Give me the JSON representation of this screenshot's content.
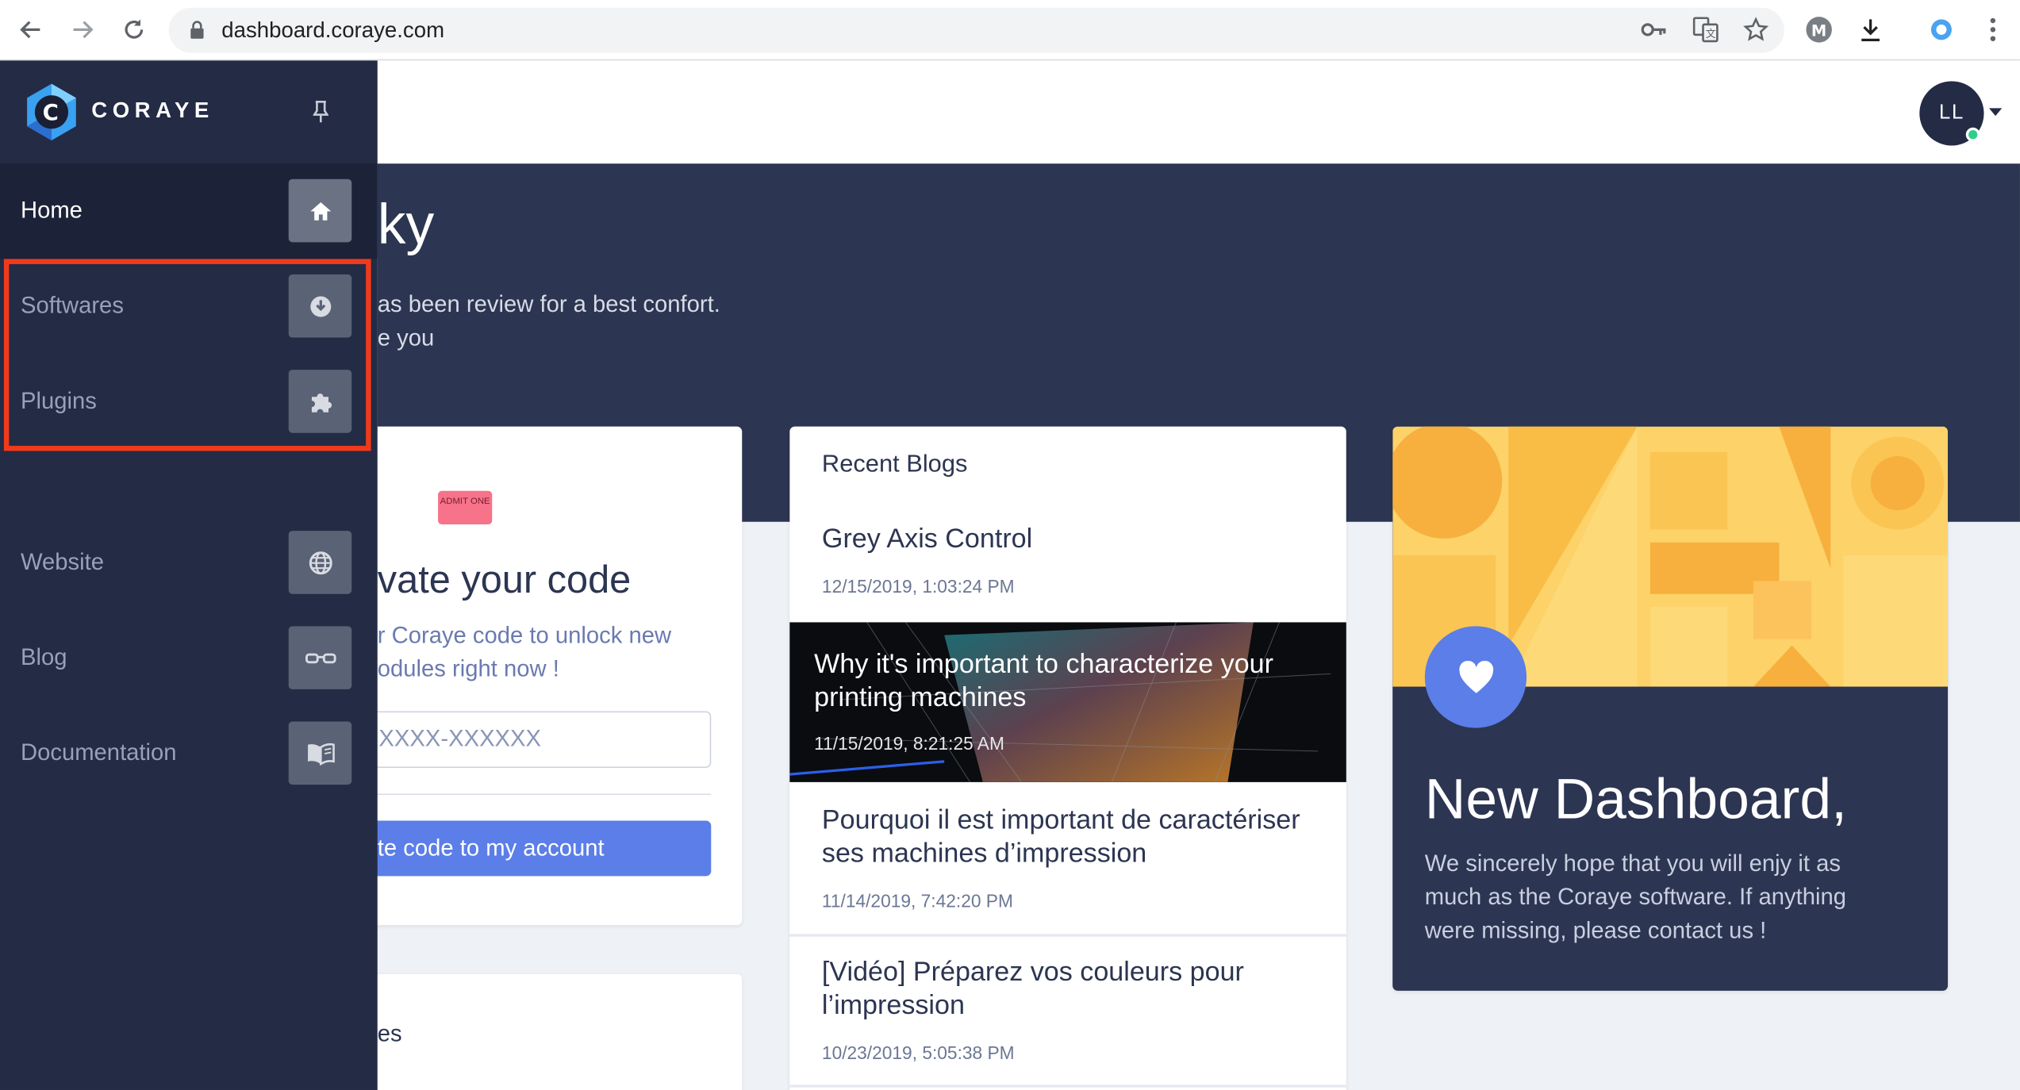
{
  "browser": {
    "url": "dashboard.coraye.com"
  },
  "sidebar": {
    "brand": "CORAYE",
    "items": [
      {
        "label": "Home",
        "icon": "home-icon"
      },
      {
        "label": "Softwares",
        "icon": "download-icon"
      },
      {
        "label": "Plugins",
        "icon": "puzzle-icon"
      },
      {
        "label": "Website",
        "icon": "globe-icon"
      },
      {
        "label": "Blog",
        "icon": "glasses-icon"
      },
      {
        "label": "Documentation",
        "icon": "book-icon"
      }
    ]
  },
  "header": {
    "avatar_initials": "LL"
  },
  "hero": {
    "title": "ky",
    "line1": "as been review for a best confort.",
    "line2": "e you"
  },
  "code_card": {
    "ticket_text": "ADMIT ONE",
    "title": "vate your code",
    "desc_line1": "r Coraye code to unlock new",
    "desc_line2": "odules right now !",
    "input_placeholder": "XXXX-XXXXXX",
    "button_label": "te code to my account"
  },
  "lower_card": {
    "label": "es"
  },
  "blogs": {
    "heading": "Recent Blogs",
    "items": [
      {
        "title": "Grey Axis Control",
        "date": "12/15/2019, 1:03:24 PM"
      },
      {
        "title": "Why it's important to characterize your printing machines",
        "date": "11/15/2019, 8:21:25 AM"
      },
      {
        "title": "Pourquoi il est important de caractériser ses machines d’impression",
        "date": "11/14/2019, 7:42:20 PM"
      },
      {
        "title": "[Vidéo] Préparez vos couleurs pour l’impression",
        "date": "10/23/2019, 5:05:38 PM"
      }
    ]
  },
  "dashboard_card": {
    "title": "New Dashboard,",
    "line1": "We sincerely hope that you will enjy it as",
    "line2": "much as the Coraye software. If anything",
    "line3": "were missing, please contact us !"
  },
  "colors": {
    "sidebar": "#232b45",
    "hero": "#2c3551",
    "accent": "#5b7ee8",
    "highlight": "#f03a1b"
  }
}
